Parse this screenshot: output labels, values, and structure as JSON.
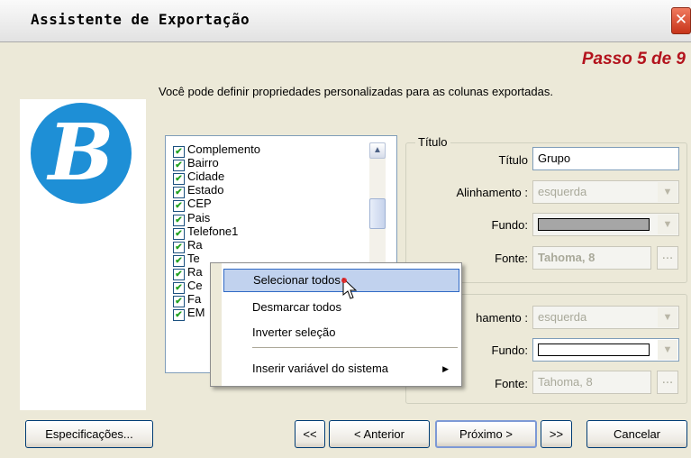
{
  "window": {
    "title": "Assistente de Exportação",
    "close_glyph": "✕"
  },
  "step": "Passo 5 de 9",
  "instruction": "Você pode definir propriedades personalizadas para as colunas exportadas.",
  "logo": {
    "letter": "B",
    "color": "#1e8fd6"
  },
  "columns": [
    {
      "label": "Complemento",
      "checked": true
    },
    {
      "label": "Bairro",
      "checked": true
    },
    {
      "label": "Cidade",
      "checked": true
    },
    {
      "label": "Estado",
      "checked": true
    },
    {
      "label": "CEP",
      "checked": true
    },
    {
      "label": "Pais",
      "checked": true
    },
    {
      "label": "Telefone1",
      "checked": true
    },
    {
      "label": "Ra",
      "checked": true
    },
    {
      "label": "Te",
      "checked": true
    },
    {
      "label": "Ra",
      "checked": true
    },
    {
      "label": "Ce",
      "checked": true
    },
    {
      "label": "Fa",
      "checked": true
    },
    {
      "label": "EM",
      "checked": true
    }
  ],
  "title_group": {
    "legend": "Título",
    "title_label": "Título",
    "title_value": "Grupo",
    "align_label": "Alinhamento :",
    "align_value": "esquerda",
    "bg_label": "Fundo:",
    "bg_color": "#a6a6a6",
    "font_label": "Fonte:",
    "font_value": "Tahoma, 8",
    "dots": "..."
  },
  "data_group": {
    "align_label": "hamento :",
    "align_value": "esquerda",
    "bg_label": "Fundo:",
    "bg_color": "#ffffff",
    "font_label": "Fonte:",
    "font_value": "Tahoma, 8",
    "dots": "..."
  },
  "context_menu": {
    "items": [
      {
        "label": "Selecionar todos",
        "highlighted": true
      },
      {
        "label": "Desmarcar todos"
      },
      {
        "label": "Inverter seleção"
      },
      {
        "label": "Inserir variável do sistema",
        "submenu": true
      }
    ]
  },
  "buttons": {
    "specs": "Especificações...",
    "first": "<<",
    "prev": "< Anterior",
    "next": "Próximo >",
    "last": ">>",
    "cancel": "Cancelar"
  }
}
